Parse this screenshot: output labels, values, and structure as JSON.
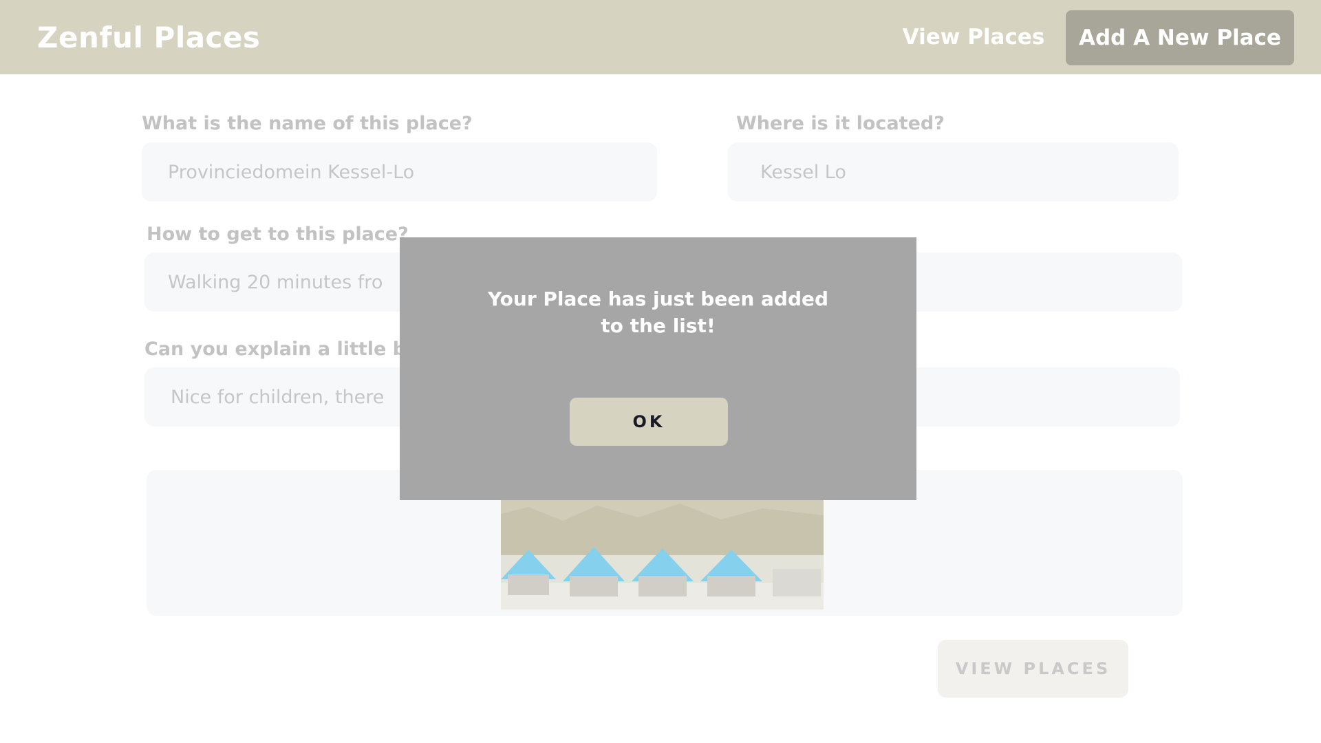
{
  "header": {
    "logo": "Zenful Places",
    "nav_view_places": "View Places",
    "nav_add_place": "Add A New Place"
  },
  "form": {
    "name_label": "What is the name of this place?",
    "name_value": "Provinciedomein Kessel-Lo",
    "location_label": "Where is it located?",
    "location_value": "Kessel Lo",
    "directions_label": "How to get to this place?",
    "directions_value": "Walking 20 minutes fro",
    "explain_label": "Can you explain a little b",
    "explain_value": "Nice for children, there",
    "view_places_button": "VIEW PLACES"
  },
  "modal": {
    "message_line1": "Your Place has just been added",
    "message_line2": "to the list!",
    "ok_button": "OK"
  },
  "colors": {
    "header_bg": "#d6d3c1",
    "nav_active_bg": "#a8a699",
    "modal_bg": "#a6a6a6",
    "field_bg": "#f7f8fa"
  }
}
